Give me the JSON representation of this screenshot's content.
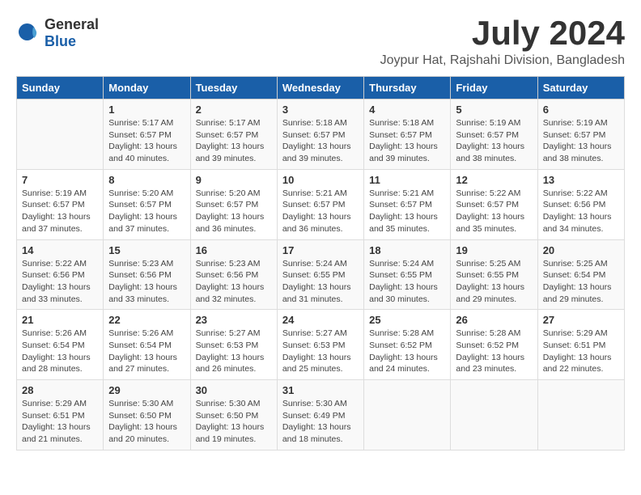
{
  "logo": {
    "general": "General",
    "blue": "Blue"
  },
  "header": {
    "month": "July 2024",
    "location": "Joypur Hat, Rajshahi Division, Bangladesh"
  },
  "weekdays": [
    "Sunday",
    "Monday",
    "Tuesday",
    "Wednesday",
    "Thursday",
    "Friday",
    "Saturday"
  ],
  "weeks": [
    [
      {
        "day": "",
        "sunrise": "",
        "sunset": "",
        "daylight": ""
      },
      {
        "day": "1",
        "sunrise": "Sunrise: 5:17 AM",
        "sunset": "Sunset: 6:57 PM",
        "daylight": "Daylight: 13 hours and 40 minutes."
      },
      {
        "day": "2",
        "sunrise": "Sunrise: 5:17 AM",
        "sunset": "Sunset: 6:57 PM",
        "daylight": "Daylight: 13 hours and 39 minutes."
      },
      {
        "day": "3",
        "sunrise": "Sunrise: 5:18 AM",
        "sunset": "Sunset: 6:57 PM",
        "daylight": "Daylight: 13 hours and 39 minutes."
      },
      {
        "day": "4",
        "sunrise": "Sunrise: 5:18 AM",
        "sunset": "Sunset: 6:57 PM",
        "daylight": "Daylight: 13 hours and 39 minutes."
      },
      {
        "day": "5",
        "sunrise": "Sunrise: 5:19 AM",
        "sunset": "Sunset: 6:57 PM",
        "daylight": "Daylight: 13 hours and 38 minutes."
      },
      {
        "day": "6",
        "sunrise": "Sunrise: 5:19 AM",
        "sunset": "Sunset: 6:57 PM",
        "daylight": "Daylight: 13 hours and 38 minutes."
      }
    ],
    [
      {
        "day": "7",
        "sunrise": "Sunrise: 5:19 AM",
        "sunset": "Sunset: 6:57 PM",
        "daylight": "Daylight: 13 hours and 37 minutes."
      },
      {
        "day": "8",
        "sunrise": "Sunrise: 5:20 AM",
        "sunset": "Sunset: 6:57 PM",
        "daylight": "Daylight: 13 hours and 37 minutes."
      },
      {
        "day": "9",
        "sunrise": "Sunrise: 5:20 AM",
        "sunset": "Sunset: 6:57 PM",
        "daylight": "Daylight: 13 hours and 36 minutes."
      },
      {
        "day": "10",
        "sunrise": "Sunrise: 5:21 AM",
        "sunset": "Sunset: 6:57 PM",
        "daylight": "Daylight: 13 hours and 36 minutes."
      },
      {
        "day": "11",
        "sunrise": "Sunrise: 5:21 AM",
        "sunset": "Sunset: 6:57 PM",
        "daylight": "Daylight: 13 hours and 35 minutes."
      },
      {
        "day": "12",
        "sunrise": "Sunrise: 5:22 AM",
        "sunset": "Sunset: 6:57 PM",
        "daylight": "Daylight: 13 hours and 35 minutes."
      },
      {
        "day": "13",
        "sunrise": "Sunrise: 5:22 AM",
        "sunset": "Sunset: 6:56 PM",
        "daylight": "Daylight: 13 hours and 34 minutes."
      }
    ],
    [
      {
        "day": "14",
        "sunrise": "Sunrise: 5:22 AM",
        "sunset": "Sunset: 6:56 PM",
        "daylight": "Daylight: 13 hours and 33 minutes."
      },
      {
        "day": "15",
        "sunrise": "Sunrise: 5:23 AM",
        "sunset": "Sunset: 6:56 PM",
        "daylight": "Daylight: 13 hours and 33 minutes."
      },
      {
        "day": "16",
        "sunrise": "Sunrise: 5:23 AM",
        "sunset": "Sunset: 6:56 PM",
        "daylight": "Daylight: 13 hours and 32 minutes."
      },
      {
        "day": "17",
        "sunrise": "Sunrise: 5:24 AM",
        "sunset": "Sunset: 6:55 PM",
        "daylight": "Daylight: 13 hours and 31 minutes."
      },
      {
        "day": "18",
        "sunrise": "Sunrise: 5:24 AM",
        "sunset": "Sunset: 6:55 PM",
        "daylight": "Daylight: 13 hours and 30 minutes."
      },
      {
        "day": "19",
        "sunrise": "Sunrise: 5:25 AM",
        "sunset": "Sunset: 6:55 PM",
        "daylight": "Daylight: 13 hours and 29 minutes."
      },
      {
        "day": "20",
        "sunrise": "Sunrise: 5:25 AM",
        "sunset": "Sunset: 6:54 PM",
        "daylight": "Daylight: 13 hours and 29 minutes."
      }
    ],
    [
      {
        "day": "21",
        "sunrise": "Sunrise: 5:26 AM",
        "sunset": "Sunset: 6:54 PM",
        "daylight": "Daylight: 13 hours and 28 minutes."
      },
      {
        "day": "22",
        "sunrise": "Sunrise: 5:26 AM",
        "sunset": "Sunset: 6:54 PM",
        "daylight": "Daylight: 13 hours and 27 minutes."
      },
      {
        "day": "23",
        "sunrise": "Sunrise: 5:27 AM",
        "sunset": "Sunset: 6:53 PM",
        "daylight": "Daylight: 13 hours and 26 minutes."
      },
      {
        "day": "24",
        "sunrise": "Sunrise: 5:27 AM",
        "sunset": "Sunset: 6:53 PM",
        "daylight": "Daylight: 13 hours and 25 minutes."
      },
      {
        "day": "25",
        "sunrise": "Sunrise: 5:28 AM",
        "sunset": "Sunset: 6:52 PM",
        "daylight": "Daylight: 13 hours and 24 minutes."
      },
      {
        "day": "26",
        "sunrise": "Sunrise: 5:28 AM",
        "sunset": "Sunset: 6:52 PM",
        "daylight": "Daylight: 13 hours and 23 minutes."
      },
      {
        "day": "27",
        "sunrise": "Sunrise: 5:29 AM",
        "sunset": "Sunset: 6:51 PM",
        "daylight": "Daylight: 13 hours and 22 minutes."
      }
    ],
    [
      {
        "day": "28",
        "sunrise": "Sunrise: 5:29 AM",
        "sunset": "Sunset: 6:51 PM",
        "daylight": "Daylight: 13 hours and 21 minutes."
      },
      {
        "day": "29",
        "sunrise": "Sunrise: 5:30 AM",
        "sunset": "Sunset: 6:50 PM",
        "daylight": "Daylight: 13 hours and 20 minutes."
      },
      {
        "day": "30",
        "sunrise": "Sunrise: 5:30 AM",
        "sunset": "Sunset: 6:50 PM",
        "daylight": "Daylight: 13 hours and 19 minutes."
      },
      {
        "day": "31",
        "sunrise": "Sunrise: 5:30 AM",
        "sunset": "Sunset: 6:49 PM",
        "daylight": "Daylight: 13 hours and 18 minutes."
      },
      {
        "day": "",
        "sunrise": "",
        "sunset": "",
        "daylight": ""
      },
      {
        "day": "",
        "sunrise": "",
        "sunset": "",
        "daylight": ""
      },
      {
        "day": "",
        "sunrise": "",
        "sunset": "",
        "daylight": ""
      }
    ]
  ]
}
